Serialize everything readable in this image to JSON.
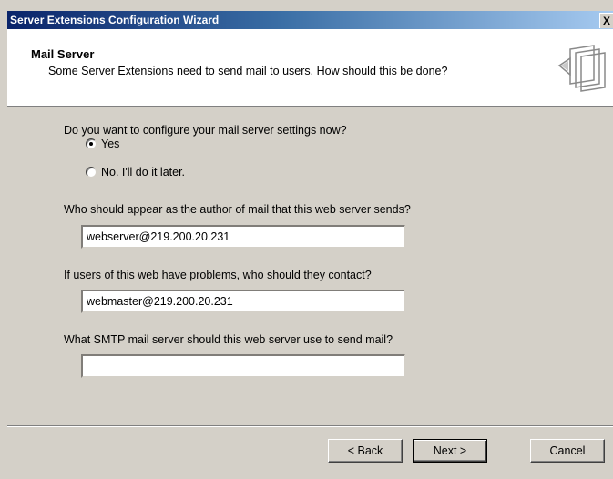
{
  "window": {
    "title": "Server Extensions Configuration Wizard",
    "close_glyph": "X"
  },
  "header": {
    "title": "Mail Server",
    "subtitle": "Some Server Extensions need to send mail to users. How should this be done?",
    "icon": "wizard-pages-icon"
  },
  "form": {
    "configure_question": "Do you want to configure your mail server settings now?",
    "options": [
      {
        "label": "Yes",
        "selected": true
      },
      {
        "label": "No. I'll do it later.",
        "selected": false
      }
    ],
    "author_question": "Who should appear as the author of mail that this web server sends?",
    "author_value": "webserver@219.200.20.231",
    "contact_question": "If users of this web have problems, who should they contact?",
    "contact_value": "webmaster@219.200.20.231",
    "smtp_question": "What SMTP mail server should this web server use to send mail?",
    "smtp_value": ""
  },
  "buttons": {
    "back": "< Back",
    "next": "Next >",
    "cancel": "Cancel"
  }
}
